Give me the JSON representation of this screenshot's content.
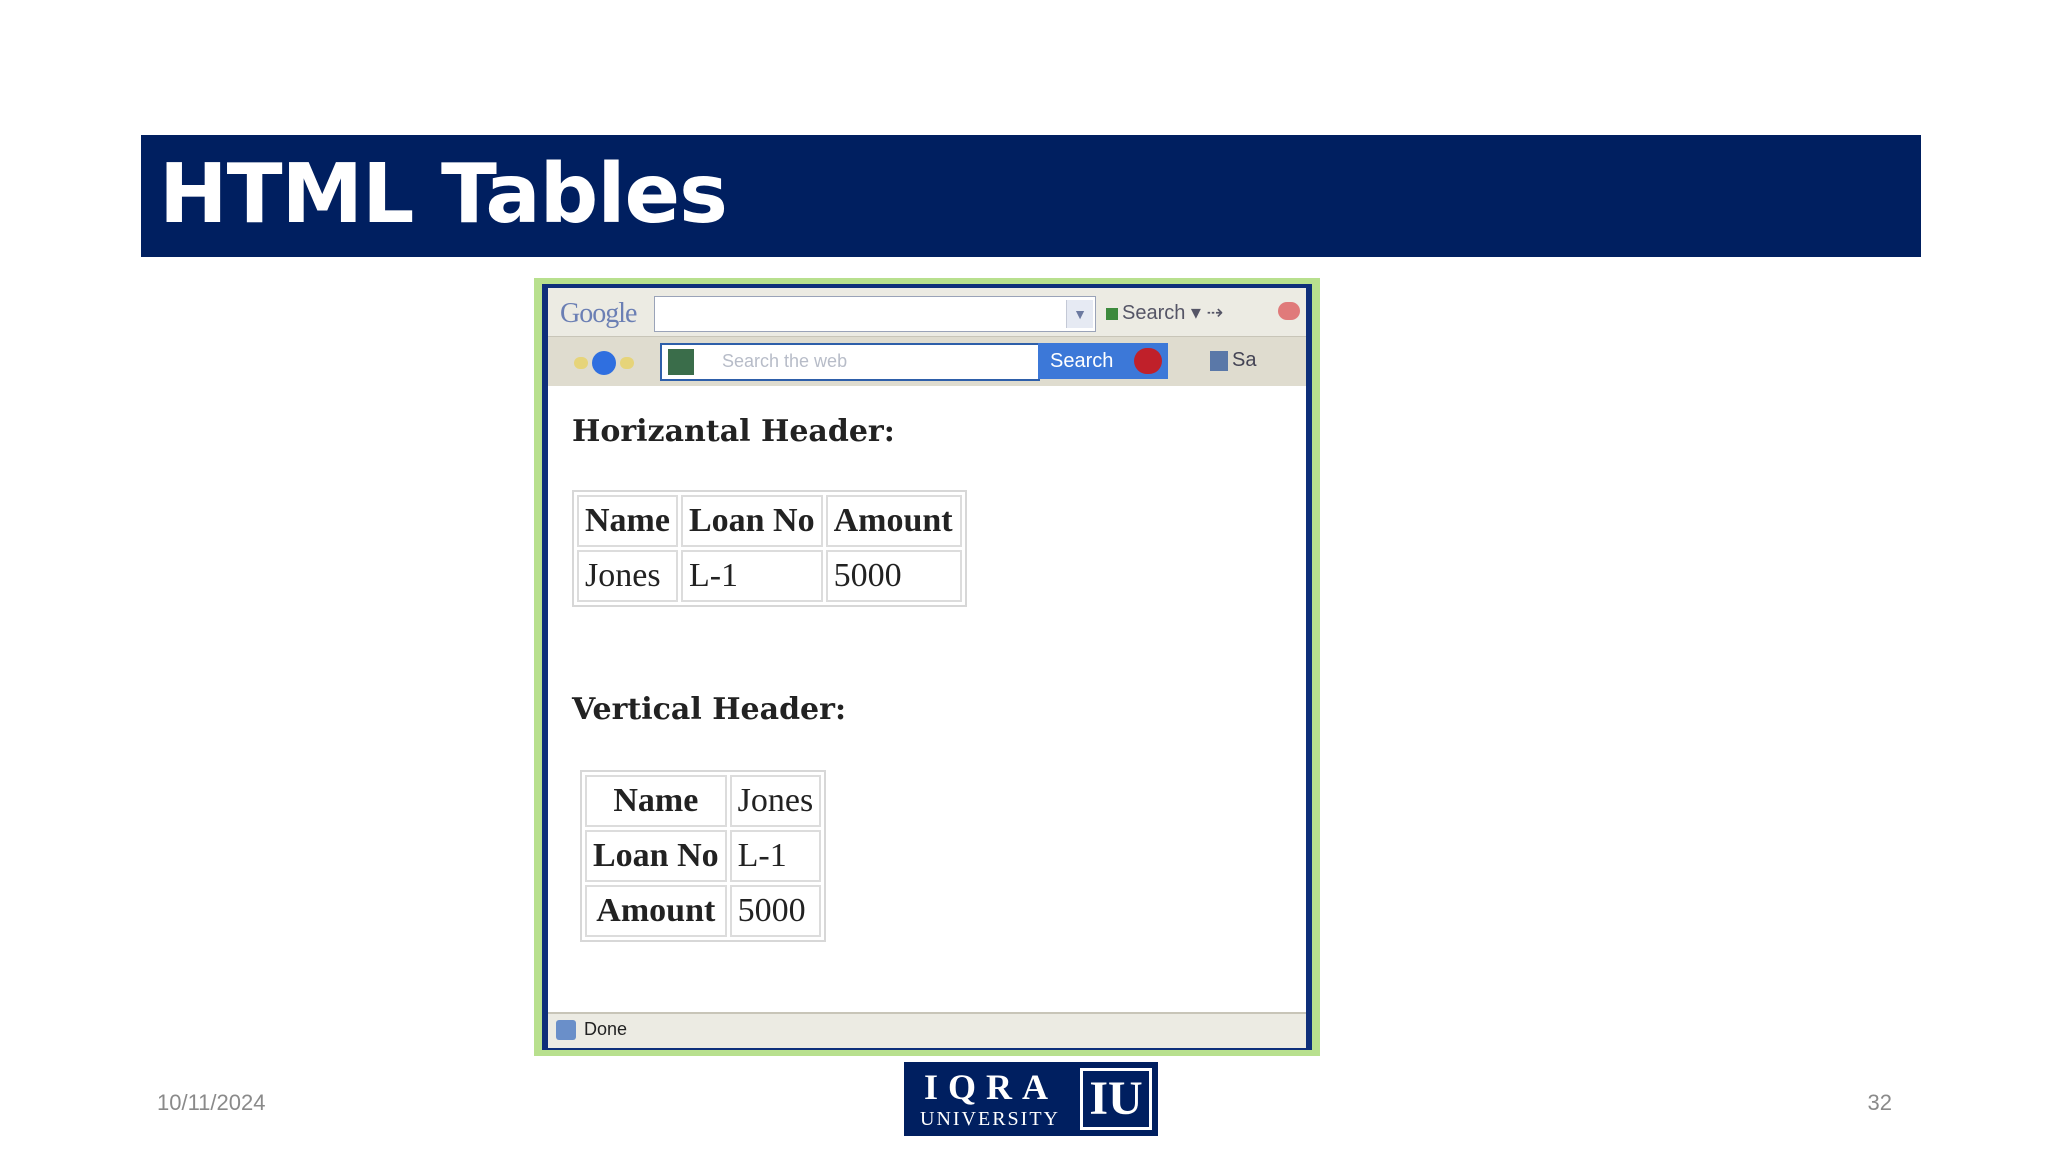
{
  "slide": {
    "title": "HTML Tables",
    "date": "10/11/2024",
    "page_number": "32",
    "logo": {
      "main": "IQRA",
      "sub": "UNIVERSITY",
      "mark": "IU"
    }
  },
  "browser": {
    "google_label": "Google",
    "google_search_button": "Search",
    "ask_placeholder": "Search the web",
    "ask_search_button": "Search",
    "save_partial": "Sa",
    "status_text": "Done"
  },
  "content": {
    "horizontal_heading": "Horizantal Header:",
    "horizontal_table": {
      "headers": [
        "Name",
        "Loan No",
        "Amount"
      ],
      "rows": [
        [
          "Jones",
          "L-1",
          "5000"
        ]
      ]
    },
    "vertical_heading": "Vertical Header:",
    "vertical_table": [
      {
        "header": "Name",
        "value": "Jones"
      },
      {
        "header": "Loan No",
        "value": "L-1"
      },
      {
        "header": "Amount",
        "value": "5000"
      }
    ]
  },
  "colors": {
    "title_bar": "#001f60",
    "frame": "#0e2f7a",
    "outer_border": "#b8e08e"
  }
}
